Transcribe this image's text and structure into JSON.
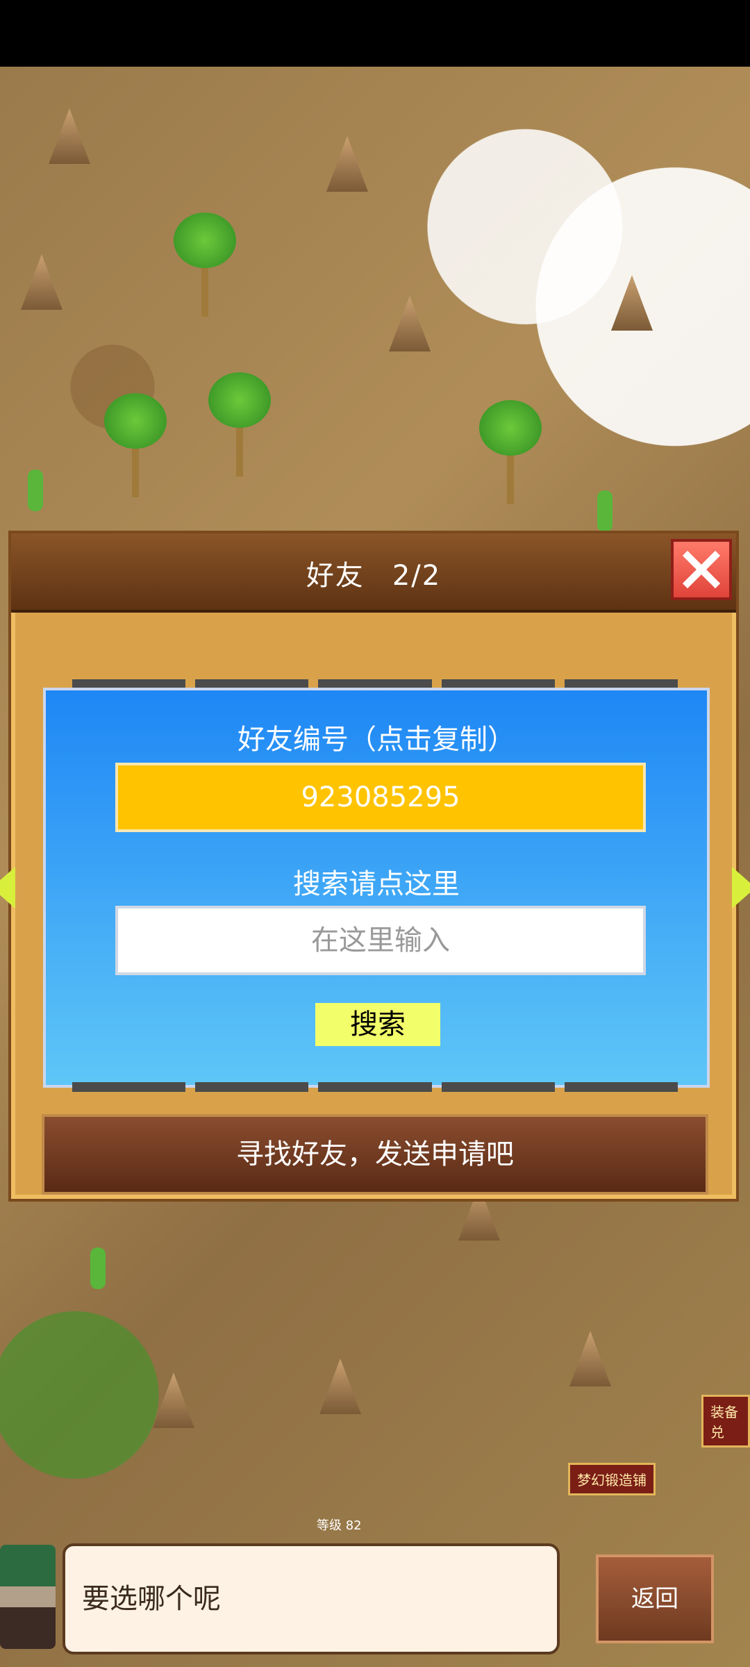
{
  "dialog": {
    "title": "好友",
    "count": "2/2",
    "friend_code_label": "好友编号（点击复制）",
    "friend_code": "923085295",
    "search_label": "搜索请点这里",
    "search_placeholder": "在这里输入",
    "search_button": "搜索",
    "request_banner": "寻找好友，发送申请吧"
  },
  "bottom": {
    "speech": "要选哪个呢",
    "back_button": "返回"
  },
  "map": {
    "building_forge": "梦幻锻造铺",
    "building_equip": "装备兑",
    "level_label": "等级",
    "level_value": "82"
  },
  "colors": {
    "close": "#e0443a",
    "friend_code_bg": "#ffc300",
    "search_button_bg": "#f3ff6a"
  }
}
